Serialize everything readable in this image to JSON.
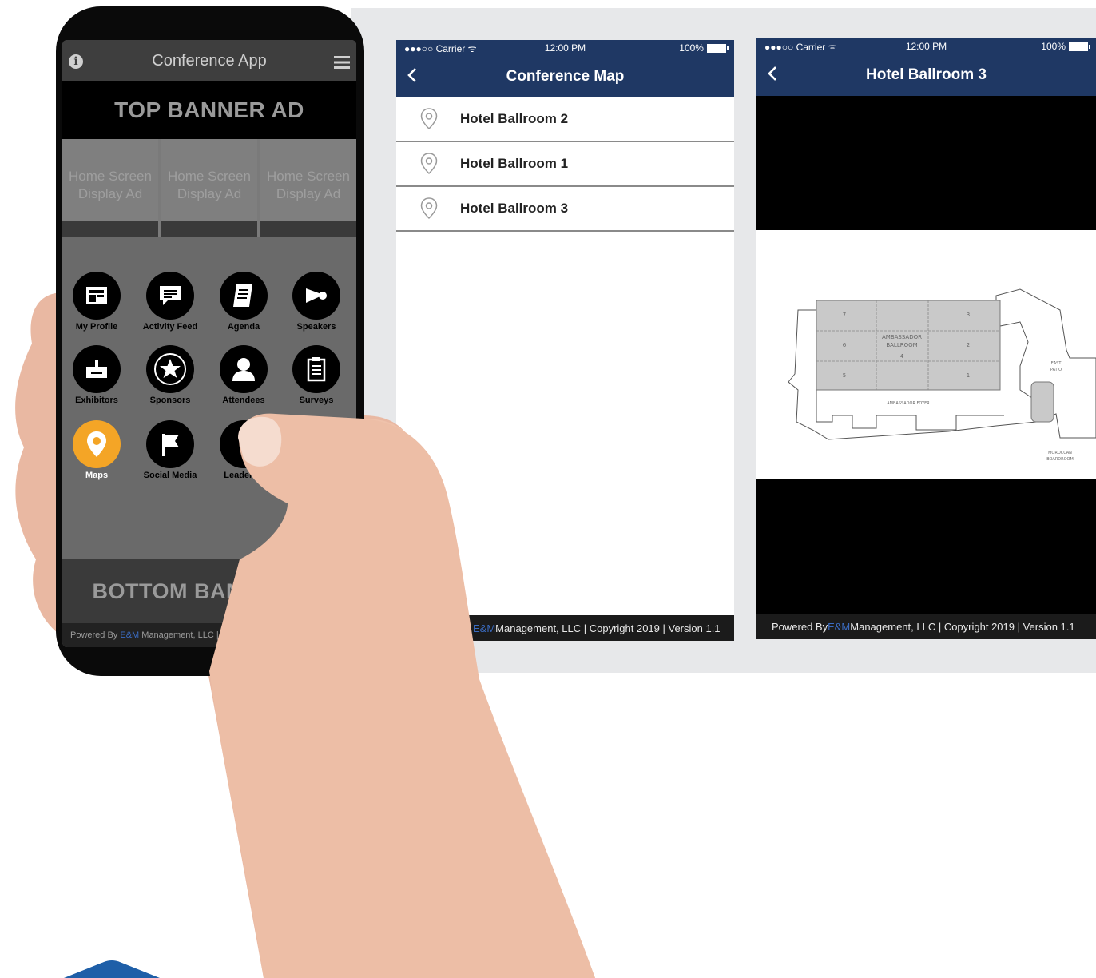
{
  "colors": {
    "nav_blue": "#1f3864",
    "accent_orange": "#f4a526",
    "em_blue": "#3b6cc2"
  },
  "left_phone": {
    "header_title": "Conference App",
    "info_icon": "info-icon",
    "menu_icon": "hamburger-menu-icon",
    "top_banner": "TOP BANNER AD",
    "display_ads": [
      "Home Screen\nDisplay Ad",
      "Home Screen\nDisplay Ad",
      "Home Screen\nDisplay Ad"
    ],
    "grid": [
      {
        "label": "My Profile",
        "icon": "profile-card-icon"
      },
      {
        "label": "Activity Feed",
        "icon": "chat-bubble-icon"
      },
      {
        "label": "Agenda",
        "icon": "notebook-icon"
      },
      {
        "label": "Speakers",
        "icon": "megaphone-icon"
      },
      {
        "label": "Exhibitors",
        "icon": "booth-icon"
      },
      {
        "label": "Sponsors",
        "icon": "star-icon"
      },
      {
        "label": "Attendees",
        "icon": "person-icon"
      },
      {
        "label": "Surveys",
        "icon": "clipboard-icon"
      },
      {
        "label": "Maps",
        "icon": "map-pin-icon"
      },
      {
        "label": "Social Media",
        "icon": "flag-icon"
      },
      {
        "label": "Leaderbo",
        "icon": "leaderboard-icon"
      }
    ],
    "bottom_banner": "BOTTOM BANNER AD",
    "footer_prefix": "Powered By ",
    "footer_em": "E&M",
    "footer_suffix": " Management, LLC | Copyright 2018 | Versio"
  },
  "screen_map": {
    "status_left": "●●●○○ Carrier ᯤ",
    "status_time": "12:00 PM",
    "status_battery": "100%",
    "title": "Conference Map",
    "items": [
      "Hotel Ballroom 2",
      "Hotel Ballroom 1",
      "Hotel Ballroom 3"
    ],
    "footer_em": "E&M",
    "footer_suffix": " Management, LLC | Copyright 2019 | Version 1.1"
  },
  "screen_ballroom": {
    "status_left": "●●●○○ Carrier ᯤ",
    "status_time": "12:00 PM",
    "status_battery": "100%",
    "title": "Hotel Ballroom 3",
    "floorplan": {
      "main_label": "AMBASSADOR\nBALLROOM",
      "main_number": "4",
      "foyer_label": "AMBASSADOR FOYER",
      "patio_label": "EAST\nPATIO",
      "boardroom_label": "MOROCCAN\nBOARDROOM",
      "sections": [
        "7",
        "3",
        "6",
        "2",
        "5",
        "1"
      ]
    },
    "footer_prefix": "Powered By ",
    "footer_em": "E&M",
    "footer_suffix": " Management, LLC | Copyright 2019 | Version 1.1"
  }
}
